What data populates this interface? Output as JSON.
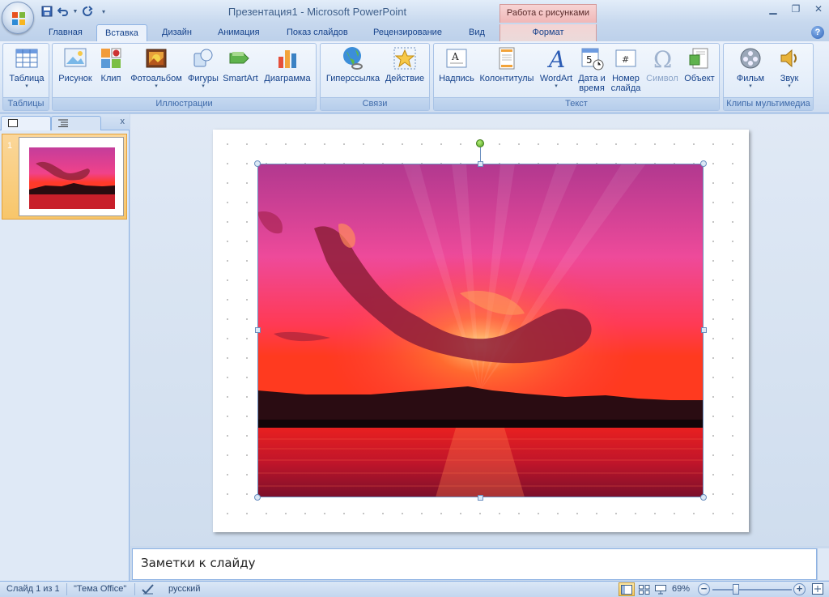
{
  "window": {
    "title": "Презентация1 - Microsoft PowerPoint",
    "context_header": "Работа с рисунками"
  },
  "tabs": [
    {
      "label": "Главная"
    },
    {
      "label": "Вставка"
    },
    {
      "label": "Дизайн"
    },
    {
      "label": "Анимация"
    },
    {
      "label": "Показ слайдов"
    },
    {
      "label": "Рецензирование"
    },
    {
      "label": "Вид"
    },
    {
      "label": "Формат"
    }
  ],
  "active_tab": "Вставка",
  "ribbon": {
    "groups": {
      "tables": "Таблицы",
      "illustrations": "Иллюстрации",
      "links": "Связи",
      "text": "Текст",
      "media": "Клипы мультимедиа"
    },
    "buttons": {
      "table": "Таблица",
      "picture": "Рисунок",
      "clip": "Клип",
      "photoalbum": "Фотоальбом",
      "shapes": "Фигуры",
      "smartart": "SmartArt",
      "chart": "Диаграмма",
      "hyperlink": "Гиперссылка",
      "action": "Действие",
      "textbox": "Надпись",
      "header_footer": "Колонтитулы",
      "wordart": "WordArt",
      "datetime_1": "Дата и",
      "datetime_2": "время",
      "slide_number_1": "Номер",
      "slide_number_2": "слайда",
      "symbol": "Символ",
      "object": "Объект",
      "movie": "Фильм",
      "sound": "Звук"
    }
  },
  "slides_pane": {
    "close": "x",
    "slides": [
      {
        "number": "1"
      }
    ]
  },
  "notes": {
    "placeholder": "Заметки к слайду"
  },
  "status": {
    "slide_info": "Слайд 1 из 1",
    "theme": "\"Тема Office\"",
    "language": "русский",
    "zoom": "69%"
  },
  "colors": {
    "ribbon_accent": "#15428b",
    "context_tab": "#f0b7b7",
    "active_thumbnail": "#f8c66a"
  }
}
